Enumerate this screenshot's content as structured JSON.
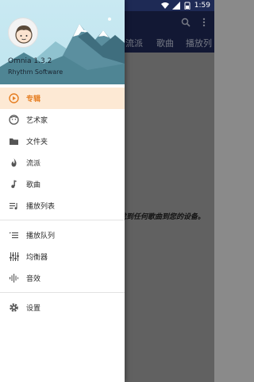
{
  "status_bar": {
    "time": "1:59"
  },
  "drawer": {
    "app_name": "Omnia 1.3.2",
    "developer": "Rhythm Software",
    "items": [
      {
        "label": "专辑",
        "icon": "album-icon",
        "active": true
      },
      {
        "label": "艺术家",
        "icon": "artist-icon",
        "active": false
      },
      {
        "label": "文件夹",
        "icon": "folder-icon",
        "active": false
      },
      {
        "label": "流派",
        "icon": "genre-icon",
        "active": false
      },
      {
        "label": "歌曲",
        "icon": "song-icon",
        "active": false
      },
      {
        "label": "播放列表",
        "icon": "playlist-icon",
        "active": false
      }
    ],
    "items2": [
      {
        "label": "播放队列",
        "icon": "queue-icon"
      },
      {
        "label": "均衡器",
        "icon": "equalizer-icon"
      },
      {
        "label": "音效",
        "icon": "audio-effects-icon"
      }
    ],
    "items3": [
      {
        "label": "设置",
        "icon": "settings-icon"
      }
    ]
  },
  "background": {
    "tabs": [
      "流派",
      "歌曲",
      "播放列"
    ],
    "empty_message": "未找到任何歌曲到您的设备。"
  },
  "colors": {
    "accent": "#e67e22",
    "active_bg": "#fde9d4",
    "appbar": "#1f2a5a"
  }
}
